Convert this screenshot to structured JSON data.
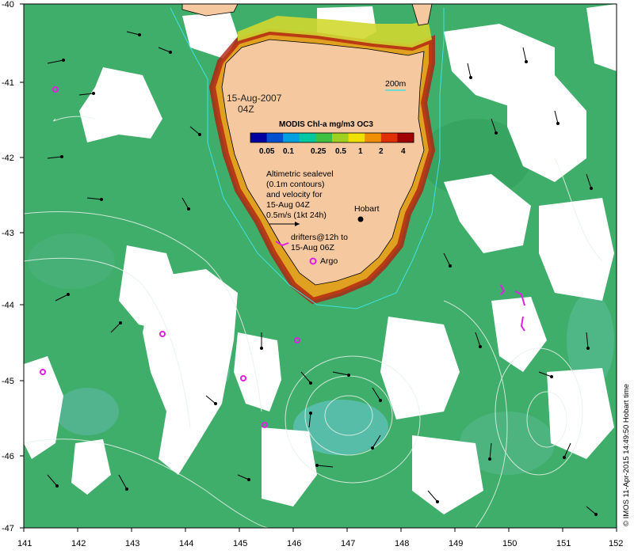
{
  "map": {
    "date_label": [
      "15-Aug-2007",
      "04Z"
    ],
    "depth_label": "200m",
    "colorbar": {
      "title": "MODIS Chl-a mg/m3 OC3",
      "ticks": [
        "0.05",
        "0.1",
        "0.25",
        "0.5",
        "1",
        "2",
        "4"
      ],
      "colors": [
        "#0000a0",
        "#0050d0",
        "#00a0e0",
        "#00c8a0",
        "#40c040",
        "#a0d020",
        "#f0e000",
        "#f09000",
        "#e03000",
        "#a00000"
      ]
    },
    "annotations": {
      "altimetry": [
        "Altimetric sealevel",
        "(0.1m contours)",
        "and velocity for",
        "15-Aug 04Z",
        "0.5m/s (1kt 24h)"
      ],
      "drifters": [
        "drifters@12h to",
        "15-Aug 06Z"
      ],
      "argo": "Argo",
      "city": "Hobart"
    },
    "axes": {
      "x_ticks": [
        "141",
        "142",
        "143",
        "144",
        "145",
        "146",
        "147",
        "148",
        "149",
        "150",
        "151",
        "152"
      ],
      "y_ticks": [
        "-40",
        "-41",
        "-42",
        "-43",
        "-44",
        "-45",
        "-46",
        "-47"
      ]
    },
    "credit": "© IMOS 11-Apr-2015 14:49:50 Hobart time",
    "colors": {
      "ocean": "#3fae6a",
      "land": "#f5c8a0",
      "cloud": "#ffffff",
      "argo": "#e020e0",
      "contour": "#e6f2e8",
      "isobath": "#40e0e0"
    }
  }
}
